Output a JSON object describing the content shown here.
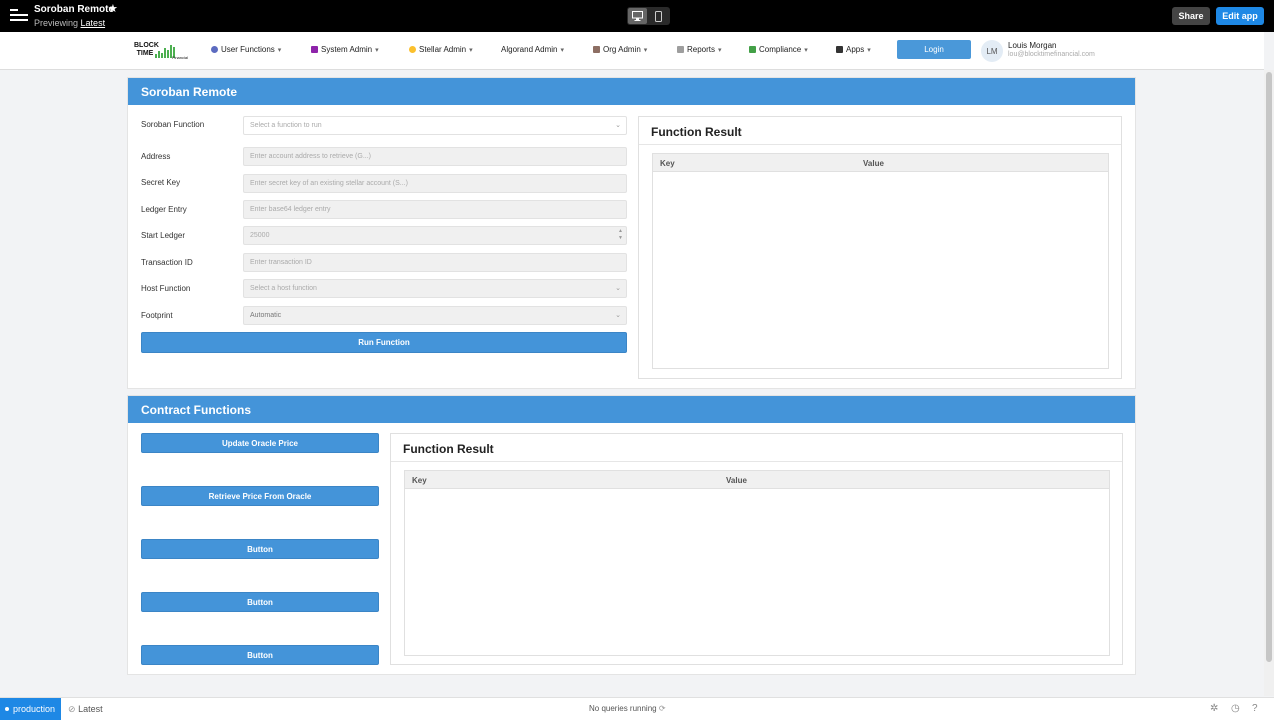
{
  "topbar": {
    "app_title": "Soroban Remote",
    "previewing_label": "Previewing",
    "previewing_version": "Latest",
    "share_label": "Share",
    "edit_label": "Edit app"
  },
  "navbar": {
    "logo_text": "BLOCK TIME",
    "logo_sub": "Financial",
    "items": [
      {
        "label": "User Functions",
        "icon": "user-icon",
        "color": "#5c6bc0"
      },
      {
        "label": "System Admin",
        "icon": "system-icon",
        "color": "#8e24aa"
      },
      {
        "label": "Stellar Admin",
        "icon": "stellar-icon",
        "color": "#fbc02d"
      },
      {
        "label": "Algorand Admin",
        "icon": "",
        "color": ""
      },
      {
        "label": "Org Admin",
        "icon": "org-icon",
        "color": "#8d6e63"
      },
      {
        "label": "Reports",
        "icon": "report-icon",
        "color": "#9e9e9e"
      },
      {
        "label": "Compliance",
        "icon": "check-icon",
        "color": "#43a047"
      },
      {
        "label": "Apps",
        "icon": "folder-icon",
        "color": "#333333"
      }
    ],
    "login_label": "Login",
    "avatar_initials": "LM",
    "user_name": "Louis Morgan",
    "user_email": "lou@blocktimefinancial.com"
  },
  "soroban": {
    "title": "Soroban Remote",
    "fields": [
      {
        "label": "Soroban Function",
        "placeholder": "Select a function to run",
        "type": "select"
      },
      {
        "label": "Address",
        "placeholder": "Enter account address to retrieve (G...)",
        "type": "text"
      },
      {
        "label": "Secret Key",
        "placeholder": "Enter secret key of an existing stellar account (S...)",
        "type": "text"
      },
      {
        "label": "Ledger Entry",
        "placeholder": "Enter base64 ledger entry",
        "type": "text"
      },
      {
        "label": "Start Ledger",
        "placeholder": "25000",
        "type": "number"
      },
      {
        "label": "Transaction ID",
        "placeholder": "Enter transaction ID",
        "type": "text"
      },
      {
        "label": "Host Function",
        "placeholder": "Select a host function",
        "type": "select"
      },
      {
        "label": "Footprint",
        "placeholder": "Automatic",
        "type": "select"
      }
    ],
    "run_label": "Run Function",
    "result_title": "Function Result",
    "col_key": "Key",
    "col_value": "Value"
  },
  "contract": {
    "title": "Contract Functions",
    "buttons": [
      "Update Oracle Price",
      "Retrieve Price From Oracle",
      "Button",
      "Button",
      "Button"
    ],
    "result_title": "Function Result",
    "col_key": "Key",
    "col_value": "Value"
  },
  "footer": {
    "environment": "production",
    "version": "Latest",
    "queries": "No queries running"
  }
}
